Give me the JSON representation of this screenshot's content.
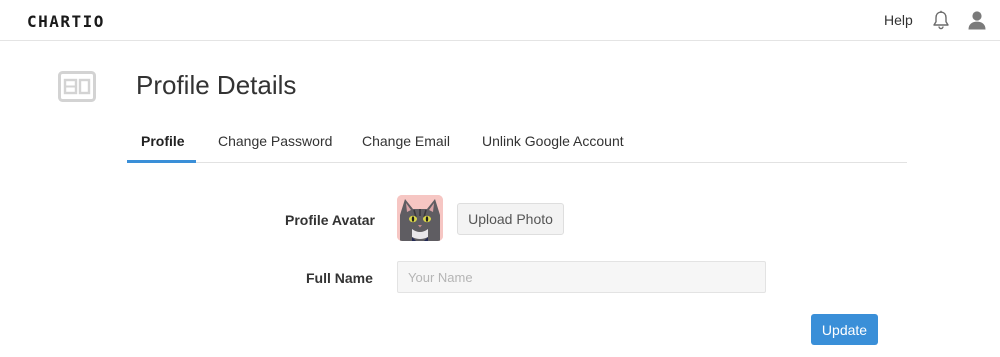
{
  "app": {
    "logo_text": "CHARTIO"
  },
  "header": {
    "help_label": "Help",
    "notifications_icon": "bell-icon",
    "user_icon": "user-icon"
  },
  "page": {
    "icon": "id-card-icon",
    "title": "Profile Details"
  },
  "tabs": [
    {
      "label": "Profile",
      "active": true
    },
    {
      "label": "Change Password",
      "active": false
    },
    {
      "label": "Change Email",
      "active": false
    },
    {
      "label": "Unlink Google Account",
      "active": false
    }
  ],
  "form": {
    "avatar_label": "Profile Avatar",
    "upload_label": "Upload Photo",
    "full_name_label": "Full Name",
    "full_name_value": "",
    "full_name_placeholder": "Your Name",
    "update_label": "Update"
  },
  "colors": {
    "accent": "#3a8fd8",
    "avatar_bg": "#f6c6c3"
  }
}
